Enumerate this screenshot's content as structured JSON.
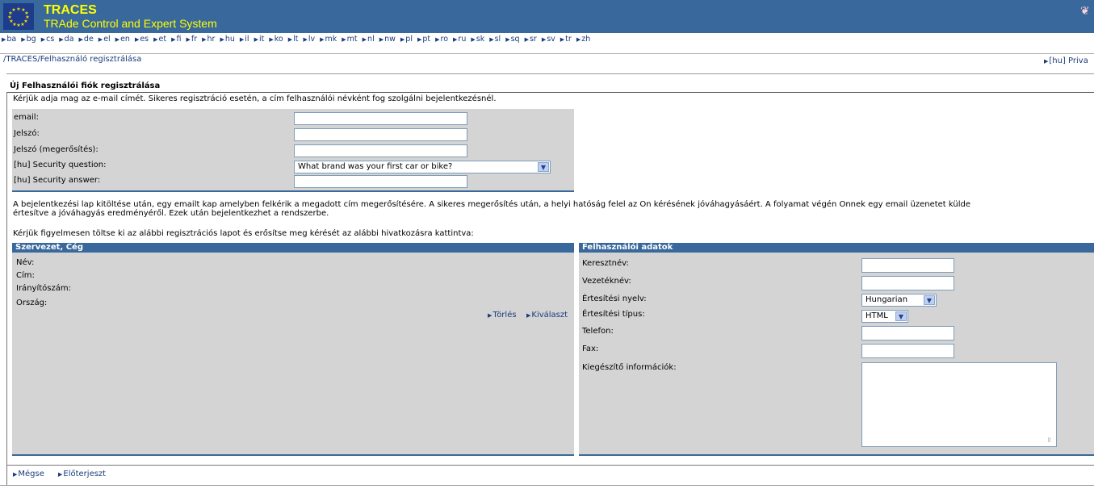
{
  "header": {
    "app_name": "TRACES",
    "app_subtitle": "TRAde Control and Expert System",
    "bg_color": "#39699c",
    "text_color": "#ffff00"
  },
  "languages": [
    "ba",
    "bg",
    "cs",
    "da",
    "de",
    "el",
    "en",
    "es",
    "et",
    "fi",
    "fr",
    "hr",
    "hu",
    "il",
    "it",
    "ko",
    "lt",
    "lv",
    "mk",
    "mt",
    "nl",
    "nw",
    "pl",
    "pt",
    "ro",
    "ru",
    "sk",
    "sl",
    "sq",
    "sr",
    "sv",
    "tr",
    "zh"
  ],
  "breadcrumb": "/TRACES/Felhasználó regisztrálása",
  "privacy_link": "[hu] Priva",
  "page_title": "Új Felhasználói fiók regisztrálása",
  "intro_text": "Kérjük adja mag az e-mail címét. Sikeres regisztráció esetén, a cím felhasználói névként fog szolgálni bejelentkezésnél.",
  "login": {
    "email_label": "email:",
    "password_label": "Jelszó:",
    "password_confirm_label": "Jelszó (megerősítés):",
    "security_question_label": "[hu] Security question:",
    "security_question_value": "What brand was your first car or bike?",
    "security_answer_label": "[hu] Security answer:"
  },
  "info_text_1": "A bejelentkezési lap kitöltése után, egy emailt kap amelyben felkérik a megadott cím megerősítésére. A sikeres megerősítés után, a helyi hatóság felel az Ön kérésének jóváhagyásáért. A folyamat végén Önnek egy email üzenetet külde",
  "info_text_2": "értesítve a jóváhagyás eredményéről. Ezek után bejelentkezhet a rendszerbe.",
  "instruction_text": "Kérjük figyelmesen töltse ki az alábbi regisztrációs lapot és erősítse meg kérését az alábbi hivatkozásra kattintva:",
  "organization": {
    "header": "Szervezet, Cég",
    "name_label": "Név:",
    "address_label": "Cím:",
    "zip_label": "Irányítószám:",
    "country_label": "Ország:",
    "delete_link": "Törlés",
    "select_link": "Kiválaszt"
  },
  "user": {
    "header": "Felhasználói adatok",
    "firstname_label": "Keresztnév:",
    "lastname_label": "Vezetéknév:",
    "notif_lang_label": "Értesítési nyelv:",
    "notif_lang_value": "Hungarian",
    "notif_type_label": "Értesítési típus:",
    "notif_type_value": "HTML",
    "phone_label": "Telefon:",
    "fax_label": "Fax:",
    "extra_label": "Kiegészítő információk:"
  },
  "footer": {
    "cancel_link": "Mégse",
    "submit_link": "Előterjeszt"
  }
}
